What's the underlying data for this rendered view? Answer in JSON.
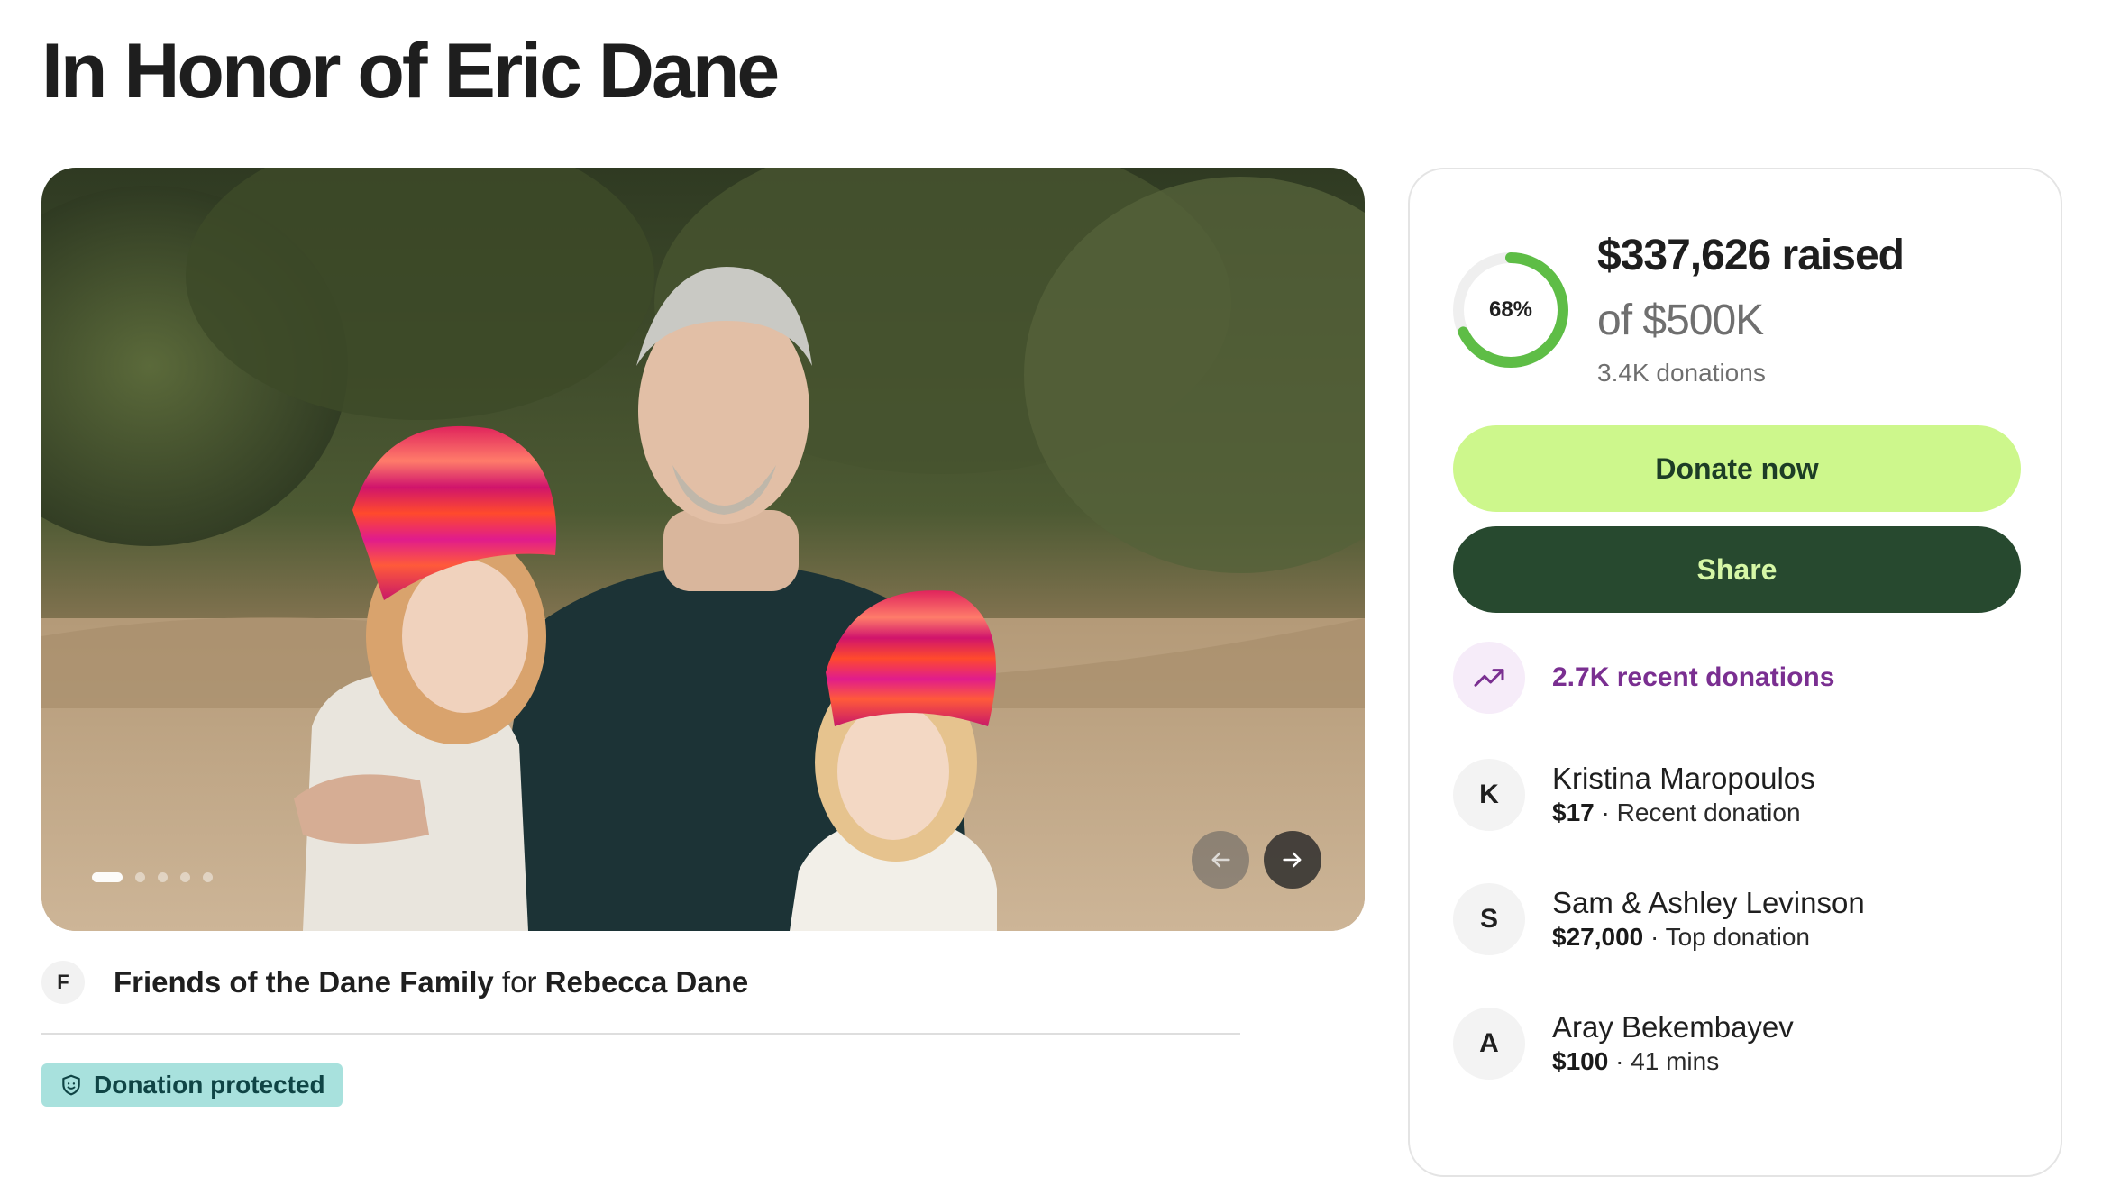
{
  "page": {
    "title": "In Honor of Eric Dane"
  },
  "hero": {
    "image_alt": "photo-of-man-with-two-girls-in-knit-hats",
    "dots_total": 5,
    "active_dot": 1,
    "prev_icon": "arrow-left-icon",
    "next_icon": "arrow-right-icon"
  },
  "organizer": {
    "avatar_initial": "F",
    "name": "Friends of the Dane Family",
    "connector": "for",
    "beneficiary": "Rebecca Dane"
  },
  "protection": {
    "icon": "shield-icon",
    "label": "Donation protected"
  },
  "fundraiser": {
    "percent_label": "68%",
    "percent_value": 0.68,
    "raised": "$337,626 raised",
    "goal": "of $500K",
    "donations": "3.4K donations",
    "donate_label": "Donate now",
    "share_label": "Share"
  },
  "recent": {
    "icon": "trending-up-icon",
    "label": "2.7K recent donations"
  },
  "donors": [
    {
      "initial": "K",
      "name": "Kristina Maropoulos",
      "amount": "$17",
      "note": "Recent donation"
    },
    {
      "initial": "S",
      "name": "Sam & Ashley Levinson",
      "amount": "$27,000",
      "note": "Top donation"
    },
    {
      "initial": "A",
      "name": "Aray Bekembayev",
      "amount": "$100",
      "note": "41 mins"
    }
  ],
  "colors": {
    "donate_bg": "#cdf78c",
    "share_bg": "#27492f",
    "progress": "#5ebd46",
    "trend": "#7a2f91",
    "badge_bg": "#a8e1dd"
  }
}
